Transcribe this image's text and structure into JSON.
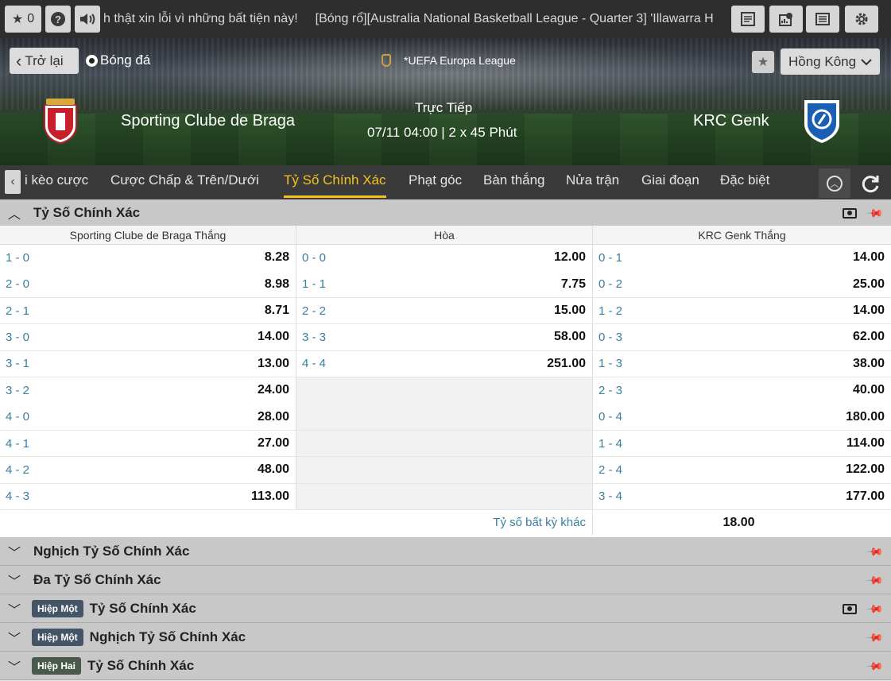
{
  "topbar": {
    "fav_count": "0",
    "ticker": [
      "h thật xin lỗi vì những bất tiện này!",
      "[Bóng rổ][Australia National Basketball League - Quarter 3] 'Illawarra H"
    ]
  },
  "header": {
    "back_label": "Trở lại",
    "sport_label": "Bóng đá",
    "league": "*UEFA Europa League",
    "region": "Hồng Kông",
    "home_team": "Sporting Clube de Braga",
    "away_team": "KRC Genk",
    "status": "Trực Tiếp",
    "kickoff": "07/11 04:00 | 2 x 45 Phút"
  },
  "tabs": [
    {
      "label": "i kèo cược"
    },
    {
      "label": "Cược Chấp & Trên/Dưới"
    },
    {
      "label": "Tỷ Số Chính Xác"
    },
    {
      "label": "Phạt góc"
    },
    {
      "label": "Bàn thắng"
    },
    {
      "label": "Nửa trận"
    },
    {
      "label": "Giai đoạn"
    },
    {
      "label": "Đặc biệt"
    }
  ],
  "market": {
    "title": "Tỷ Số Chính Xác",
    "columns": [
      "Sporting Clube de Braga Thắng",
      "Hòa",
      "KRC Genk Thắng"
    ],
    "home": [
      {
        "score": "1 - 0",
        "odds": "8.28"
      },
      {
        "score": "2 - 0",
        "odds": "8.98"
      },
      {
        "score": "2 - 1",
        "odds": "8.71"
      },
      {
        "score": "3 - 0",
        "odds": "14.00"
      },
      {
        "score": "3 - 1",
        "odds": "13.00"
      },
      {
        "score": "3 - 2",
        "odds": "24.00"
      },
      {
        "score": "4 - 0",
        "odds": "28.00"
      },
      {
        "score": "4 - 1",
        "odds": "27.00"
      },
      {
        "score": "4 - 2",
        "odds": "48.00"
      },
      {
        "score": "4 - 3",
        "odds": "113.00"
      }
    ],
    "draw": [
      {
        "score": "0 - 0",
        "odds": "12.00"
      },
      {
        "score": "1 - 1",
        "odds": "7.75"
      },
      {
        "score": "2 - 2",
        "odds": "15.00"
      },
      {
        "score": "3 - 3",
        "odds": "58.00"
      },
      {
        "score": "4 - 4",
        "odds": "251.00"
      }
    ],
    "away": [
      {
        "score": "0 - 1",
        "odds": "14.00"
      },
      {
        "score": "0 - 2",
        "odds": "25.00"
      },
      {
        "score": "1 - 2",
        "odds": "14.00"
      },
      {
        "score": "0 - 3",
        "odds": "62.00"
      },
      {
        "score": "1 - 3",
        "odds": "38.00"
      },
      {
        "score": "2 - 3",
        "odds": "40.00"
      },
      {
        "score": "0 - 4",
        "odds": "180.00"
      },
      {
        "score": "1 - 4",
        "odds": "114.00"
      },
      {
        "score": "2 - 4",
        "odds": "122.00"
      },
      {
        "score": "3 - 4",
        "odds": "177.00"
      }
    ],
    "other_label": "Tỷ số bất kỳ khác",
    "other_odds": "18.00"
  },
  "sections": [
    {
      "title": "Nghịch Tỷ Số Chính Xác",
      "badge": "",
      "tv": false
    },
    {
      "title": "Đa Tỷ Số Chính Xác",
      "badge": "",
      "tv": false
    },
    {
      "title": "Tỷ Số Chính Xác",
      "badge": "Hiệp Một",
      "tv": true
    },
    {
      "title": "Nghịch Tỷ Số Chính Xác",
      "badge": "Hiệp Một",
      "tv": false
    },
    {
      "title": "Tỷ Số Chính Xác",
      "badge": "Hiệp Hai",
      "tv": false
    }
  ]
}
